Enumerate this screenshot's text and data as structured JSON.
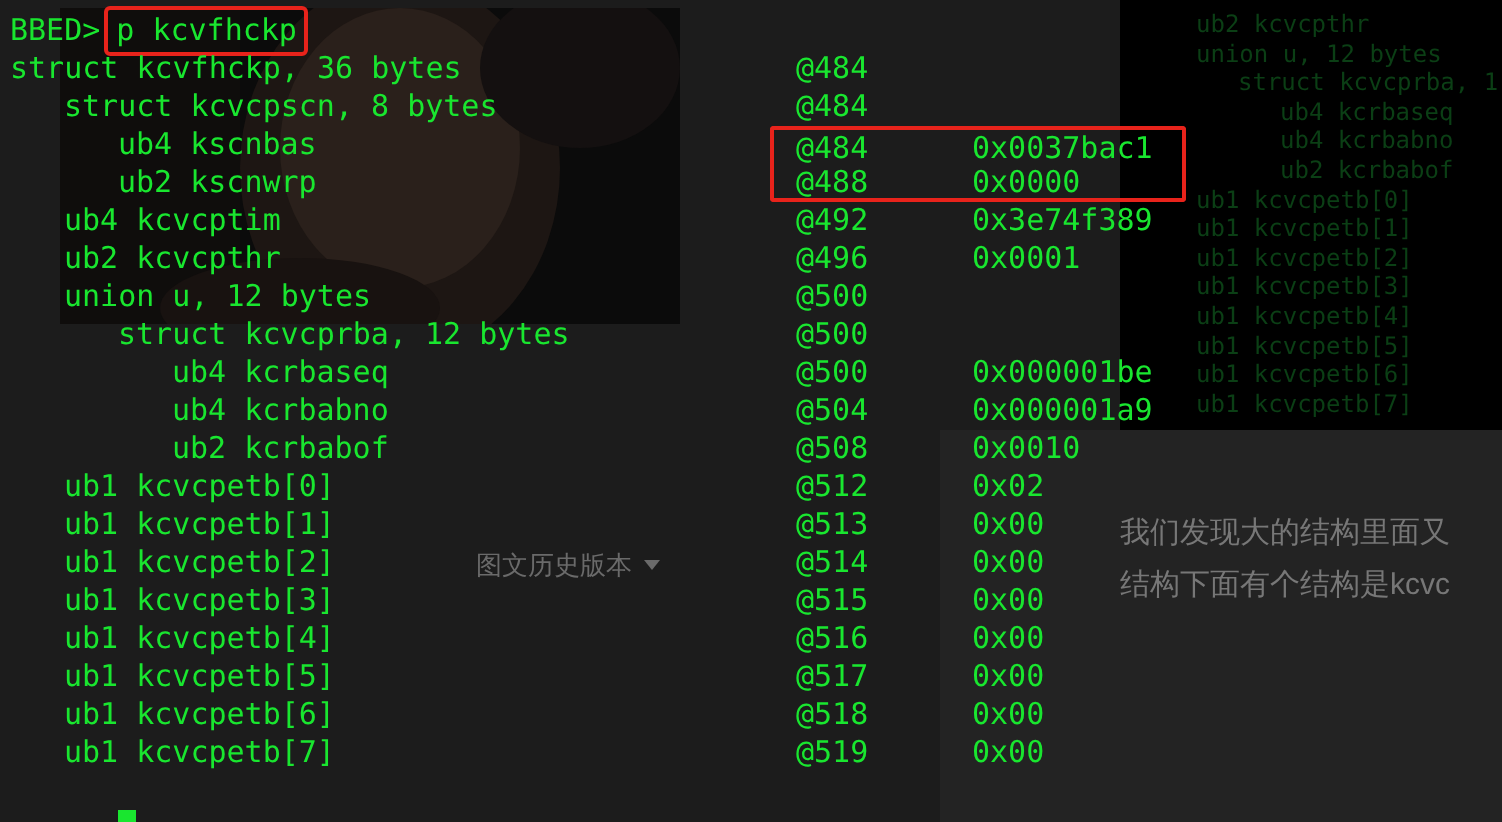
{
  "prompt": {
    "label": "BBED>",
    "command": "p kcvfhckp"
  },
  "fields": [
    {
      "text": "struct kcvfhckp, 36 bytes",
      "offset": "@484",
      "highlighted": false,
      "children": [
        {
          "text": "struct kcvcpscn, 8 bytes",
          "offset": "@484",
          "highlighted": false,
          "children": [
            {
              "text": "ub4 kscnbas",
              "offset": "@484",
              "value": "0x0037bac1",
              "highlighted": true
            },
            {
              "text": "ub2 kscnwrp",
              "offset": "@488",
              "value": "0x0000",
              "highlighted": true
            }
          ]
        },
        {
          "text": "ub4 kcvcptim",
          "offset": "@492",
          "value": "0x3e74f389",
          "highlighted": false
        },
        {
          "text": "ub2 kcvcpthr",
          "offset": "@496",
          "value": "0x0001",
          "highlighted": false
        },
        {
          "text": "union u, 12 bytes",
          "offset": "@500",
          "highlighted": false,
          "children": [
            {
              "text": "struct kcvcprba, 12 bytes",
              "offset": "@500",
              "highlighted": false,
              "children": [
                {
                  "text": "ub4 kcrbaseq",
                  "offset": "@500",
                  "value": "0x000001be",
                  "highlighted": false
                },
                {
                  "text": "ub4 kcrbabno",
                  "offset": "@504",
                  "value": "0x000001a9",
                  "highlighted": false
                },
                {
                  "text": "ub2 kcrbabof",
                  "offset": "@508",
                  "value": "0x0010",
                  "highlighted": false
                }
              ]
            }
          ]
        },
        {
          "text": "ub1 kcvcpetb[0]",
          "offset": "@512",
          "value": "0x02",
          "highlighted": false
        },
        {
          "text": "ub1 kcvcpetb[1]",
          "offset": "@513",
          "value": "0x00",
          "highlighted": false
        },
        {
          "text": "ub1 kcvcpetb[2]",
          "offset": "@514",
          "value": "0x00",
          "highlighted": false
        },
        {
          "text": "ub1 kcvcpetb[3]",
          "offset": "@515",
          "value": "0x00",
          "highlighted": false
        },
        {
          "text": "ub1 kcvcpetb[4]",
          "offset": "@516",
          "value": "0x00",
          "highlighted": false
        },
        {
          "text": "ub1 kcvcpetb[5]",
          "offset": "@517",
          "value": "0x00",
          "highlighted": false
        },
        {
          "text": "ub1 kcvcpetb[6]",
          "offset": "@518",
          "value": "0x00",
          "highlighted": false
        },
        {
          "text": "ub1 kcvcpetb[7]",
          "offset": "@519",
          "value": "0x00",
          "highlighted": false
        }
      ]
    }
  ],
  "background_terminal": {
    "lines": [
      {
        "text": "ub2 kcvcpthr"
      },
      {
        "text": "union u, 12 bytes",
        "children": [
          {
            "text": "struct kcvcprba, 1",
            "children": [
              {
                "text": "ub4 kcrbaseq"
              },
              {
                "text": "ub4 kcrbabno"
              },
              {
                "text": "ub2 kcrbabof"
              }
            ]
          }
        ]
      },
      {
        "text": "ub1 kcvcpetb[0]"
      },
      {
        "text": "ub1 kcvcpetb[1]"
      },
      {
        "text": "ub1 kcvcpetb[2]"
      },
      {
        "text": "ub1 kcvcpetb[3]"
      },
      {
        "text": "ub1 kcvcpetb[4]"
      },
      {
        "text": "ub1 kcvcpetb[5]"
      },
      {
        "text": "ub1 kcvcpetb[6]"
      },
      {
        "text": "ub1 kcvcpetb[7]"
      }
    ]
  },
  "background_page": {
    "history_menu": "图文历史版本",
    "paragraph_lines": [
      "我们发现大的结构里面又",
      "结构下面有个结构是kcvc"
    ]
  }
}
